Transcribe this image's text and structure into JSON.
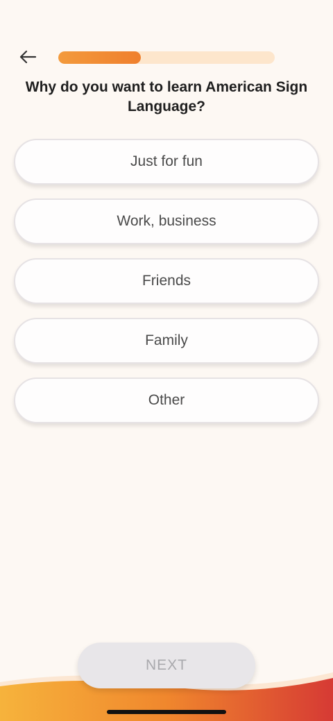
{
  "header": {
    "back_icon": "arrow-left-icon",
    "progress": 0.38
  },
  "question": "Why do you want to learn American Sign Language?",
  "options": [
    {
      "label": "Just for fun"
    },
    {
      "label": "Work, business"
    },
    {
      "label": "Friends"
    },
    {
      "label": "Family"
    },
    {
      "label": "Other"
    }
  ],
  "footer": {
    "next_label": "NEXT"
  },
  "colors": {
    "accent": "#f08a32",
    "progress_track": "#fde6cc",
    "wave_start": "#f6a73a",
    "wave_end": "#d83a34",
    "background": "#fdf8f3"
  }
}
